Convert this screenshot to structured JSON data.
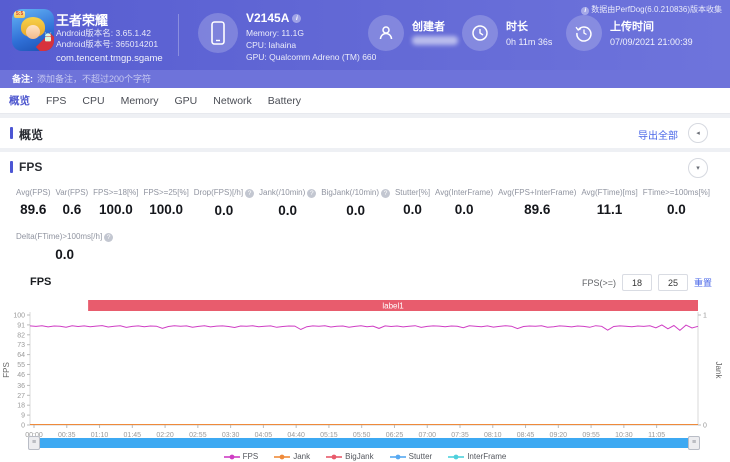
{
  "header": {
    "app": {
      "name": "王者荣耀",
      "badge": "5:5",
      "version_name": "Android版本名: 3.65.1.42",
      "version_code": "Android版本号: 365014201",
      "package": "com.tencent.tmgp.sgame"
    },
    "device": {
      "model": "V2145A",
      "memory": "Memory: 11.1G",
      "cpu": "CPU: lahaina",
      "gpu": "GPU: Qualcomm Adreno (TM) 660"
    },
    "creator": {
      "label": "创建者"
    },
    "duration": {
      "label": "时长",
      "value": "0h 11m 36s"
    },
    "upload": {
      "label": "上传时间",
      "value": "07/09/2021 21:00:39"
    },
    "collector_note": "数据由PerfDog(6.0.210836)版本收集"
  },
  "note_bar": {
    "label": "备注:",
    "placeholder": "添加备注，不超过200个字符"
  },
  "tabs": [
    "概览",
    "FPS",
    "CPU",
    "Memory",
    "GPU",
    "Network",
    "Battery"
  ],
  "active_tab": "概览",
  "overview": {
    "title": "概览",
    "export_label": "导出全部"
  },
  "icons": {
    "collapse_left": "◂",
    "collapse_down": "▾",
    "info": "i",
    "help": "?",
    "grip": "≡"
  },
  "fps_section": {
    "title": "FPS",
    "stats": [
      {
        "label": "Avg(FPS)",
        "value": "89.6",
        "help": false
      },
      {
        "label": "Var(FPS)",
        "value": "0.6",
        "help": false
      },
      {
        "label": "FPS>=18[%]",
        "value": "100.0",
        "help": false
      },
      {
        "label": "FPS>=25[%]",
        "value": "100.0",
        "help": false
      },
      {
        "label": "Drop(FPS)[/h]",
        "value": "0.0",
        "help": true
      },
      {
        "label": "Jank(/10min)",
        "value": "0.0",
        "help": true
      },
      {
        "label": "BigJank(/10min)",
        "value": "0.0",
        "help": true
      },
      {
        "label": "Stutter[%]",
        "value": "0.0",
        "help": false
      },
      {
        "label": "Avg(InterFrame)",
        "value": "0.0",
        "help": false
      },
      {
        "label": "Avg(FPS+InterFrame)",
        "value": "89.6",
        "help": false
      },
      {
        "label": "Avg(FTime)[ms]",
        "value": "11.1",
        "help": false
      },
      {
        "label": "FTime>=100ms[%]",
        "value": "0.0",
        "help": false
      }
    ],
    "row2": [
      {
        "label": "Delta(FTime)>100ms[/h]",
        "value": "0.0",
        "help": true
      }
    ],
    "controls": {
      "label": "FPS(>=)",
      "input1": "18",
      "input2": "25",
      "reset": "重置"
    }
  },
  "chart_data": {
    "type": "line",
    "title": "FPS",
    "annotation_band": {
      "label": "label1",
      "color": "#e85c6d",
      "x_start_frac": 0.087,
      "x_end_frac": 1.0
    },
    "y_left": {
      "label": "FPS",
      "min": 0,
      "max": 100,
      "ticks": [
        100,
        91,
        82,
        73,
        64,
        55,
        46,
        36,
        27,
        18,
        9,
        0
      ]
    },
    "y_right": {
      "label": "Jank",
      "min": 0,
      "max": 1,
      "ticks": [
        1,
        0
      ]
    },
    "x_ticks": [
      "00:00",
      "00:35",
      "01:10",
      "01:45",
      "02:20",
      "02:55",
      "03:30",
      "04:05",
      "04:40",
      "05:15",
      "05:50",
      "06:25",
      "07:00",
      "07:35",
      "08:10",
      "08:45",
      "09:20",
      "09:55",
      "10:30",
      "11:05"
    ],
    "grid": false,
    "legend_position": "bottom",
    "series": [
      {
        "name": "FPS",
        "color": "#cf3dc4",
        "axis": "left",
        "avg": 89.6,
        "values": [
          90.1,
          89.6,
          90.3,
          89.2,
          90.0,
          89.8,
          88.9,
          90.2,
          89.5,
          90.1,
          89.3,
          89.9,
          90.4,
          89.1,
          89.7,
          90.2,
          88.7,
          89.6,
          90.1,
          89.4,
          90.0,
          89.8,
          87.9,
          89.5,
          90.2,
          89.7,
          90.1,
          88.9,
          89.6,
          90.3,
          89.2,
          89.9,
          90.1,
          89.5,
          88.6,
          90.0,
          89.8,
          90.2,
          89.3,
          89.7,
          90.1,
          88.8,
          89.5,
          90.0,
          89.9,
          86.8,
          89.4,
          90.1,
          89.8,
          90.2,
          89.1,
          89.7,
          90.0,
          88.9,
          89.6,
          90.2,
          89.4,
          89.9,
          87.8,
          90.1,
          89.5,
          90.0,
          89.2,
          89.8,
          90.3,
          88.7,
          89.6,
          90.1,
          89.9,
          89.3,
          90.0,
          89.7,
          88.5,
          90.2,
          89.8,
          89.4,
          90.1,
          89.0,
          89.6,
          90.2,
          89.8,
          87.6,
          89.5,
          90.0,
          89.7,
          90.2,
          88.9,
          89.4,
          90.1,
          89.8,
          89.2,
          90.0,
          89.6,
          88.8,
          90.3,
          89.7,
          86.2,
          89.5,
          90.1,
          89.8,
          89.3,
          90.0,
          89.6,
          90.2,
          88.4,
          91.0,
          87.5,
          90.5,
          86.0,
          90.8,
          88.2,
          89.7
        ]
      },
      {
        "name": "Jank",
        "color": "#ef8a3a",
        "axis": "right",
        "values": [
          0,
          0
        ]
      },
      {
        "name": "BigJank",
        "color": "#e85a6b",
        "axis": "right",
        "values": [
          0,
          0
        ]
      },
      {
        "name": "Stutter",
        "color": "#57a9f2",
        "axis": "right",
        "values": [
          0,
          0
        ]
      },
      {
        "name": "InterFrame",
        "color": "#4fd0dc",
        "axis": "left",
        "values": [
          0,
          0
        ]
      }
    ]
  }
}
